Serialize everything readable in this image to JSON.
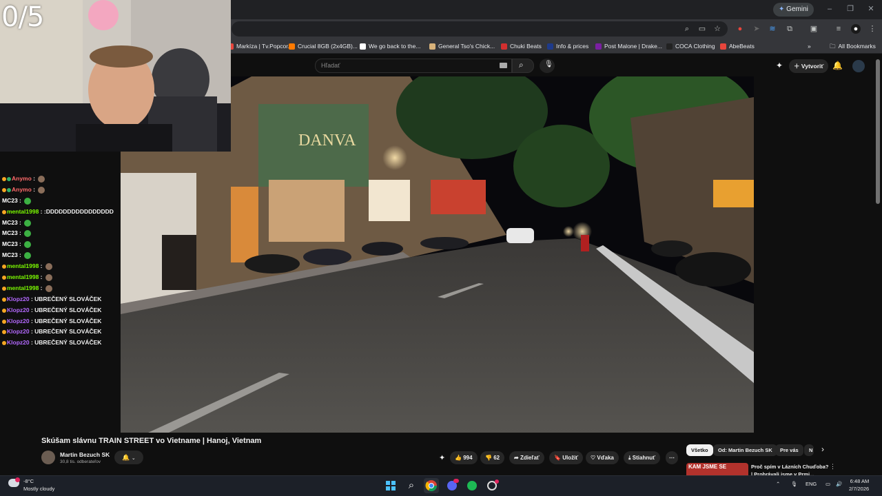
{
  "overlay": {
    "counter": "0/5"
  },
  "browser": {
    "gemini_label": "Gemini",
    "bookmarks": [
      "Markíza | Tv.Popcor...",
      "Crucial 8GB (2x4GB)...",
      "We go back to the...",
      "General Tso's Chick...",
      "Chuki Beats",
      "Info & prices",
      "Post Malone | Drake...",
      "COCA Clothing",
      "AbeBeats"
    ],
    "all_bookmarks": "All Bookmarks",
    "bookmark_colors": [
      "#e8453c",
      "#ff7a00",
      "#ffffff",
      "#d8b27a",
      "#d32f2f",
      "#1e3a8a",
      "#7b1fa2",
      "#222222",
      "#e8453c"
    ]
  },
  "youtube": {
    "search_placeholder": "Hľadať",
    "create_label": "Vytvoriť",
    "video_title": "Skúšam slávnu TRAIN STREET vo Vietname | Hanoj, Vietnam",
    "channel_name": "Martin Bezuch SK",
    "subscribers": "30,8 tis. odberateľov",
    "likes": "994",
    "dislikes": "62",
    "share_label": "Zdieľať",
    "save_label": "Uložiť",
    "thanks_label": "Vďaka",
    "download_label": "Stiahnuť",
    "chips": [
      "Všetko",
      "Od: Martin Bezuch SK",
      "Pre vás",
      "N"
    ],
    "recommendation": {
      "title": "Proč spím v Lázních Chuďoba? | Prohrávali jsme v Prmi...",
      "thumb_text": "KAM JSME SE"
    }
  },
  "chat": [
    {
      "user": "Anymo",
      "text": "",
      "color": "#ff6b6b",
      "emote": true
    },
    {
      "user": "Anymo",
      "text": "",
      "color": "#ff6b6b",
      "emote": true
    },
    {
      "user": "MC23",
      "text": "",
      "color": "#ffffff",
      "emote": true
    },
    {
      "user": "mental1998",
      "text": ":DDDDDDDDDDDDDDDD",
      "color": "#7cfc00",
      "emote": false
    },
    {
      "user": "MC23",
      "text": "",
      "color": "#ffffff",
      "emote": true
    },
    {
      "user": "MC23",
      "text": "",
      "color": "#ffffff",
      "emote": true
    },
    {
      "user": "MC23",
      "text": "",
      "color": "#ffffff",
      "emote": true
    },
    {
      "user": "MC23",
      "text": "",
      "color": "#ffffff",
      "emote": true
    },
    {
      "user": "mental1998",
      "text": "",
      "color": "#7cfc00",
      "emote": true
    },
    {
      "user": "mental1998",
      "text": "",
      "color": "#7cfc00",
      "emote": true
    },
    {
      "user": "mental1998",
      "text": "",
      "color": "#7cfc00",
      "emote": true
    },
    {
      "user": "Klopz20",
      "text": "UBREČENÝ SLOVÁČEK",
      "color": "#b469ff",
      "emote": false
    },
    {
      "user": "Klopz20",
      "text": "UBREČENÝ SLOVÁČEK",
      "color": "#b469ff",
      "emote": false
    },
    {
      "user": "Klopz20",
      "text": "UBREČENÝ SLOVÁČEK",
      "color": "#b469ff",
      "emote": false
    },
    {
      "user": "Klopz20",
      "text": "UBREČENÝ SLOVÁČEK",
      "color": "#b469ff",
      "emote": false
    },
    {
      "user": "Klopz20",
      "text": "UBREČENÝ SLOVÁČEK",
      "color": "#b469ff",
      "emote": false
    }
  ],
  "taskbar": {
    "temp": "-8°C",
    "weather": "Mostly cloudy",
    "lang": "ENG",
    "time": "6:48 AM",
    "date": "2/7/2026"
  }
}
